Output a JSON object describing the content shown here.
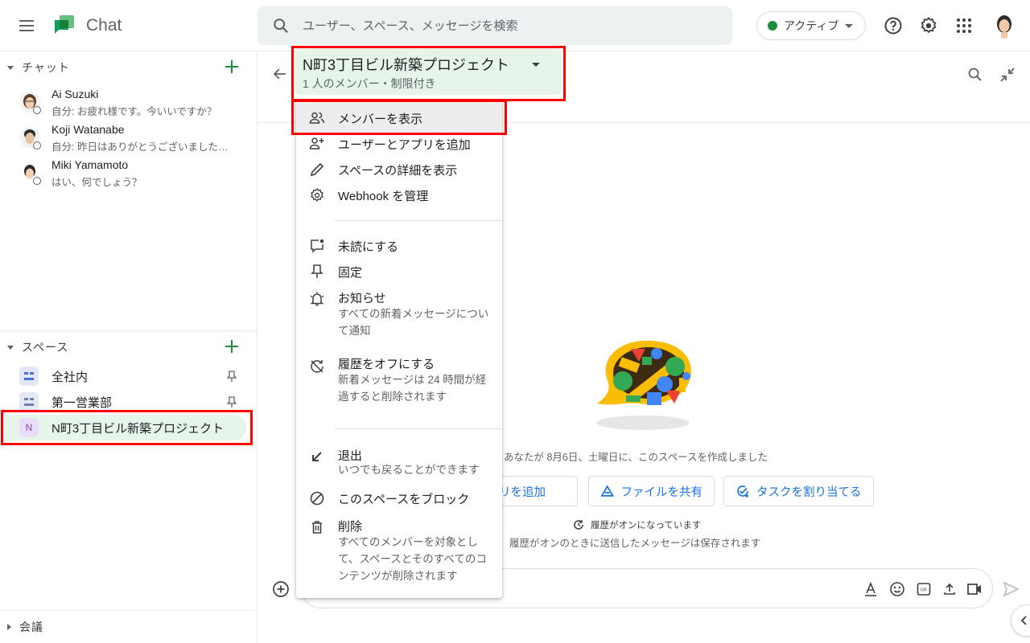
{
  "app": {
    "title": "Chat",
    "search_placeholder": "ユーザー、スペース、メッセージを検索",
    "status": "アクティブ",
    "colors": {
      "accent_green": "#1e8e3e",
      "highlight": "#ff0000",
      "link_blue": "#1a73e8",
      "active_bg": "#e6f4ea"
    }
  },
  "sidebar": {
    "chat_section": {
      "title": "チャット",
      "items": [
        {
          "name": "Ai Suzuki",
          "snippet": "自分: お疲れ様です。今いいですか？"
        },
        {
          "name": "Koji Watanabe",
          "snippet": "自分: 昨日はありがとうございました…"
        },
        {
          "name": "Miki Yamamoto",
          "snippet": "はい、何でしょう？"
        }
      ]
    },
    "spaces_section": {
      "title": "スペース",
      "items": [
        {
          "name": "全社内",
          "avatar": "grid",
          "pinned": true
        },
        {
          "name": "第一営業部",
          "avatar": "grid",
          "pinned": true
        },
        {
          "name": "N町3丁目ビル新築プロジェクト",
          "avatar": "N",
          "pinned": false,
          "active": true
        }
      ]
    },
    "meetings_section": {
      "title": "会議"
    }
  },
  "main": {
    "space_title": "N町3丁目ビル新築プロジェクト",
    "space_subtitle": "1 人のメンバー・制限付き",
    "created_text": "あなたが 8月6日、土曜日に、このスペースを作成しました",
    "actions": [
      {
        "label": "アプリを追加",
        "icon": "add-app-icon"
      },
      {
        "label": "ファイルを共有",
        "icon": "drive-icon"
      },
      {
        "label": "タスクを割り当てる",
        "icon": "add-task-icon"
      }
    ],
    "history_on": "履歴がオンになっています",
    "history_desc": "履歴がオンのときに送信したメッセージは保存されます",
    "composer_placeholder": ""
  },
  "menu": {
    "items": [
      {
        "label": "メンバーを表示",
        "icon": "people-icon",
        "highlighted": true
      },
      {
        "label": "ユーザーとアプリを追加",
        "icon": "person-add-icon"
      },
      {
        "label": "スペースの詳細を表示",
        "icon": "pencil-icon"
      },
      {
        "label": "Webhook を管理",
        "icon": "gear-icon"
      },
      {
        "label": "未読にする",
        "icon": "mark-unread-icon"
      },
      {
        "label": "固定",
        "icon": "pin-icon"
      },
      {
        "label": "お知らせ",
        "desc": "すべての新着メッセージについて通知",
        "icon": "bell-icon"
      },
      {
        "label": "履歴をオフにする",
        "desc": "新着メッセージは 24 時間が経過すると削除されます",
        "icon": "history-off-icon"
      },
      {
        "label": "退出",
        "desc": "いつでも戻ることができます",
        "icon": "leave-icon"
      },
      {
        "label": "このスペースをブロック",
        "icon": "block-icon"
      },
      {
        "label": "削除",
        "desc": "すべてのメンバーを対象として、スペースとそのすべてのコンテンツが削除されます",
        "icon": "trash-icon"
      }
    ]
  }
}
